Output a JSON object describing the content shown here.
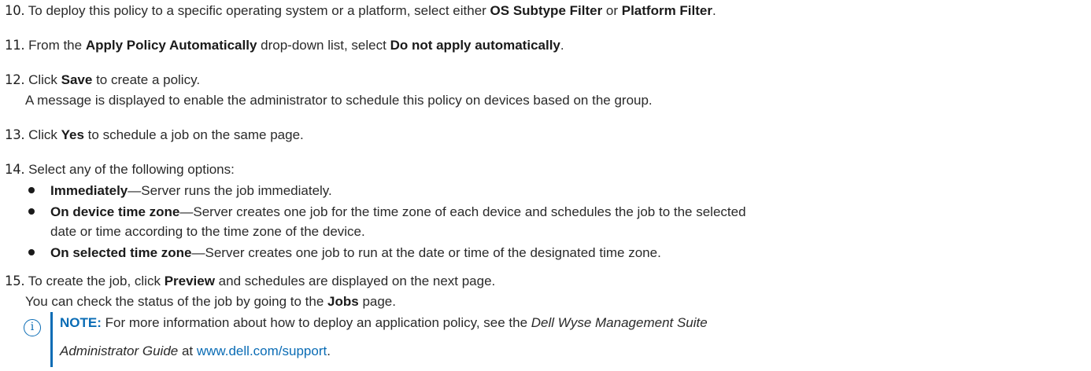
{
  "steps": [
    {
      "num": "10.",
      "pre": "To deploy this policy to a specific operating system or a platform, select either ",
      "b1": "OS Subtype Filter",
      "mid": " or ",
      "b2": "Platform Filter",
      "post": "."
    },
    {
      "num": "11.",
      "pre": "From the ",
      "b1": "Apply Policy Automatically",
      "mid": " drop-down list, select ",
      "b2": "Do not apply automatically",
      "post": "."
    },
    {
      "num": "12.",
      "pre": "Click ",
      "b1": "Save",
      "post": " to create a policy.",
      "sub": "A message is displayed to enable the administrator to schedule this policy on devices based on the group."
    },
    {
      "num": "13.",
      "pre": "Click ",
      "b1": "Yes",
      "post": " to schedule a job on the same page."
    },
    {
      "num": "14.",
      "pre": "Select any of the following options:",
      "bullets": [
        {
          "b": "Immediately",
          "text": "—Server runs the job immediately."
        },
        {
          "b": "On device time zone",
          "text": "—Server creates one job for the time zone of each device and schedules the job to the selected",
          "cont": "date or time according to the time zone of the device."
        },
        {
          "b": "On selected time zone",
          "text": "—Server creates one job to run at the date or time of the designated time zone."
        }
      ]
    },
    {
      "num": "15.",
      "pre": "To create the job, click ",
      "b1": "Preview",
      "post": " and schedules are displayed on the next page.",
      "sub_pre": "You can check the status of the job by going to the ",
      "sub_b": "Jobs",
      "sub_post": " page."
    }
  ],
  "note": {
    "label": "NOTE:",
    "pre": " For more information about how to deploy an application policy, see the ",
    "italic1": "Dell Wyse Management Suite",
    "italic2": "Administrator Guide",
    "mid": " at ",
    "link": "www.dell.com/support",
    "post": ".",
    "icon": "info-icon",
    "accent": "#0a6cb5"
  }
}
